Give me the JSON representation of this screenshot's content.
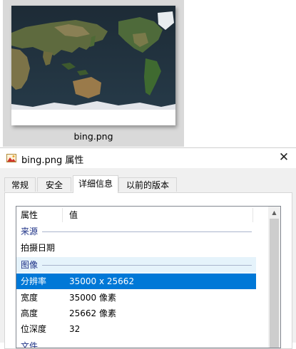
{
  "explorer": {
    "file_label": "bing.png"
  },
  "dialog": {
    "title": "bing.png 属性",
    "close_glyph": "✕",
    "tabs": [
      {
        "label": "常规",
        "active": false
      },
      {
        "label": "安全",
        "active": false
      },
      {
        "label": "详细信息",
        "active": true
      },
      {
        "label": "以前的版本",
        "active": false
      }
    ],
    "columns": {
      "name": "属性",
      "value": "值"
    },
    "groups": {
      "source": "来源",
      "image": "图像",
      "partial": "文件"
    },
    "rows": {
      "date_taken": {
        "name": "拍摄日期",
        "value": ""
      },
      "resolution": {
        "name": "分辨率",
        "value": "35000 x 25662"
      },
      "width": {
        "name": "宽度",
        "value": "35000 像素"
      },
      "height": {
        "name": "高度",
        "value": "25662 像素"
      },
      "bit_depth": {
        "name": "位深度",
        "value": "32"
      }
    },
    "scroll_up_glyph": "▲"
  },
  "colors": {
    "selection": "#0078d7",
    "group_text": "#1e3287",
    "tile_bg": "#d9d9d9"
  },
  "icons": {
    "title_icon": "image-file-icon",
    "close": "close-icon"
  }
}
